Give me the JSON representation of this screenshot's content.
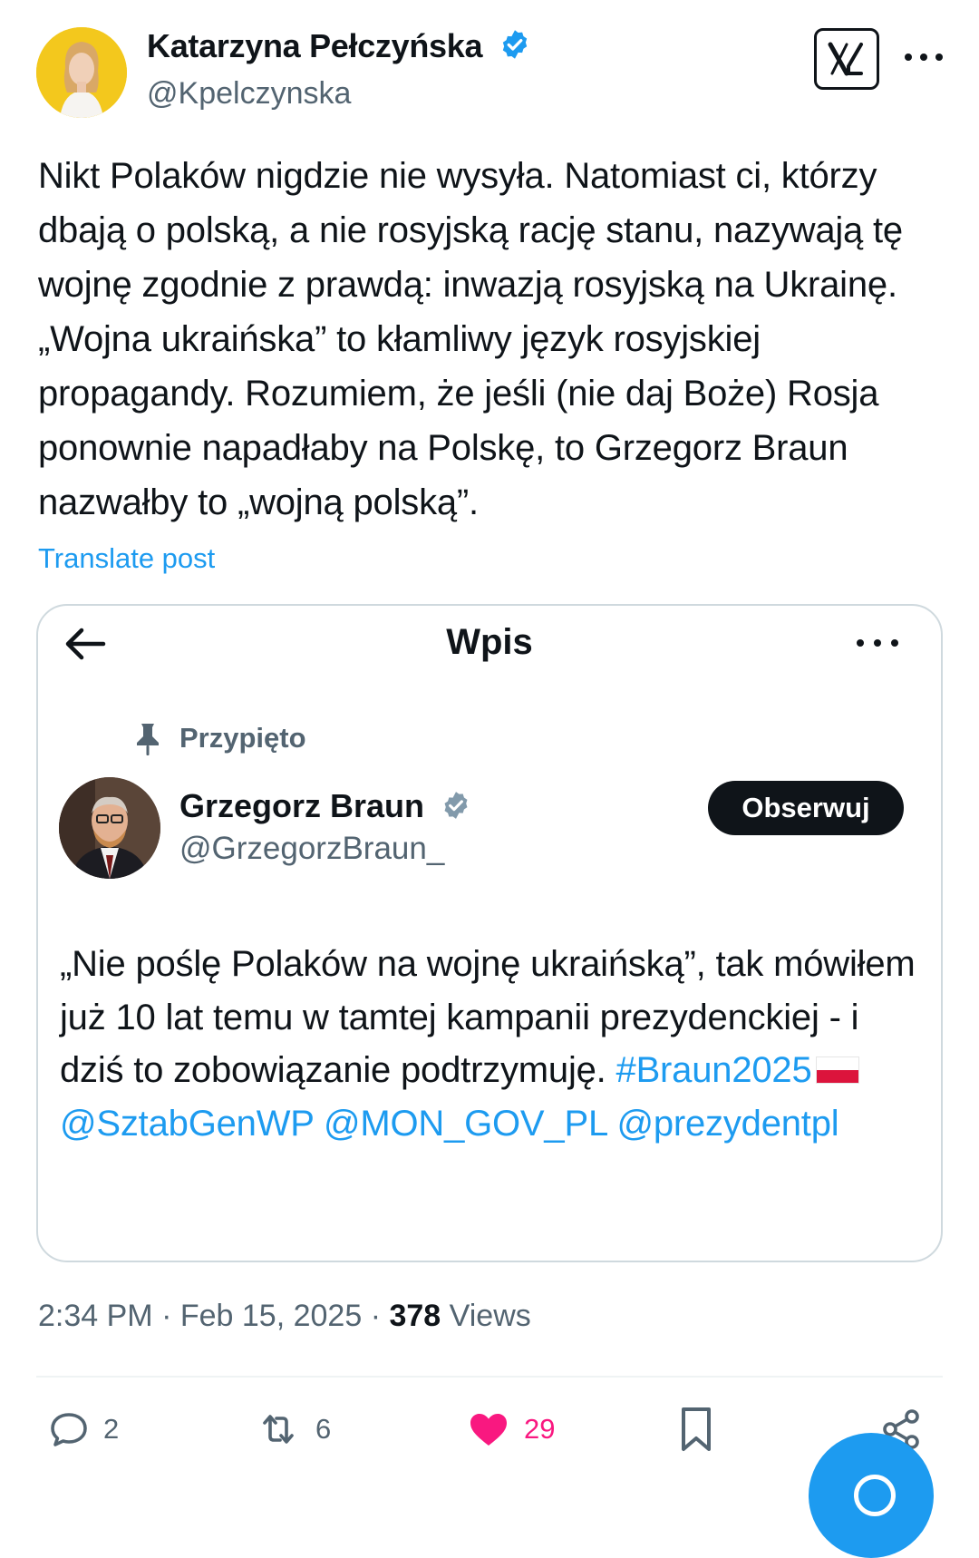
{
  "post": {
    "author_name": "Katarzyna Pełczyńska",
    "author_handle": "@Kpelczynska",
    "text": "Nikt Polaków nigdzie nie wysyła. Natomiast ci, którzy dbają o polską, a nie rosyjską rację stanu, nazywają tę wojnę zgodnie z prawdą: inwazją rosyjską na Ukrainę. „Wojna ukraińska” to kłamliwy język rosyjskiej propagandy. Rozumiem, że jeśli (nie daj Boże) Rosja ponownie napadłaby na Polskę, to Grzegorz Braun nazwałby to „wojną polską”.",
    "translate_label": "Translate post",
    "time": "2:34 PM",
    "date": "Feb 15, 2025",
    "views_count": "378",
    "views_label": "Views"
  },
  "quoted": {
    "header_title": "Wpis",
    "pinned_label": "Przypięto",
    "author_name": "Grzegorz Braun",
    "author_handle": "@GrzegorzBraun_",
    "follow_label": "Obserwuj",
    "text_plain": "„Nie poślę Polaków na wojnę ukraińską”, tak mówiłem już 10 lat temu w tamtej kampanii prezydenckiej - i dziś to zobowiązanie podtrzymuję.",
    "hashtag": "#Braun2025",
    "mention_1": "@SztabGenWP",
    "mention_2": "@MON_GOV_PL",
    "mention_3": "@prezydentpl"
  },
  "actions": {
    "replies": "2",
    "reposts": "6",
    "likes": "29"
  },
  "colors": {
    "accent": "#1d9bf0",
    "like": "#f91880",
    "secondary_text": "#536471"
  },
  "icons": [
    "x-logo-icon",
    "more-icon",
    "back-arrow-icon",
    "pin-icon",
    "verified-icon",
    "reply-icon",
    "repost-icon",
    "like-icon",
    "bookmark-icon",
    "share-icon"
  ]
}
